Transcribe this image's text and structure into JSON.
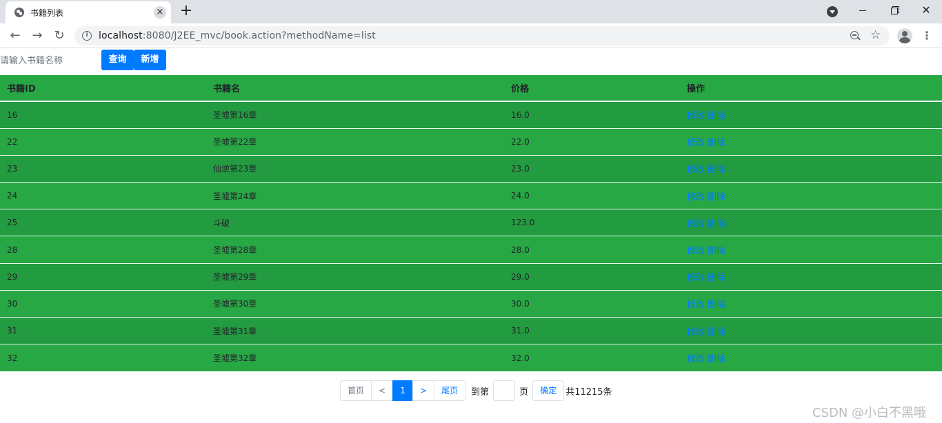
{
  "browser": {
    "tab_title": "书籍列表",
    "tab_close_glyph": "×",
    "new_tab_glyph": "+",
    "url_host": "localhost",
    "url_path": ":8080/J2EE_mvc/book.action?methodName=list",
    "back_glyph": "←",
    "forward_glyph": "→",
    "reload_glyph": "↻",
    "star_glyph": "☆",
    "menu_glyph": "⋮",
    "close_glyph": "✕"
  },
  "search": {
    "placeholder": "请输入书籍名称",
    "query_label": "查询",
    "add_label": "新增"
  },
  "table": {
    "headers": [
      "书籍ID",
      "书籍名",
      "价格",
      "操作"
    ],
    "edit_label": "修改",
    "delete_label": "删除",
    "rows": [
      {
        "id": "16",
        "name": "圣墟第16章",
        "price": "16.0"
      },
      {
        "id": "22",
        "name": "圣墟第22章",
        "price": "22.0"
      },
      {
        "id": "23",
        "name": "仙逆第23章",
        "price": "23.0"
      },
      {
        "id": "24",
        "name": "圣墟第24章",
        "price": "24.0"
      },
      {
        "id": "25",
        "name": "斗破",
        "price": "123.0"
      },
      {
        "id": "28",
        "name": "圣墟第28章",
        "price": "28.0"
      },
      {
        "id": "29",
        "name": "圣墟第29章",
        "price": "29.0"
      },
      {
        "id": "30",
        "name": "圣墟第30章",
        "price": "30.0"
      },
      {
        "id": "31",
        "name": "圣墟第31章",
        "price": "31.0"
      },
      {
        "id": "32",
        "name": "圣墟第32章",
        "price": "32.0"
      }
    ]
  },
  "pager": {
    "first": "首页",
    "prev": "<",
    "current": "1",
    "next": ">",
    "last": "尾页",
    "goto_label": "到第",
    "page_label": "页",
    "confirm": "确定",
    "total": "共11215条"
  },
  "watermark": "CSDN @小白不黑哦",
  "colors": {
    "table_green": "#28a745",
    "primary_blue": "#007bff"
  }
}
